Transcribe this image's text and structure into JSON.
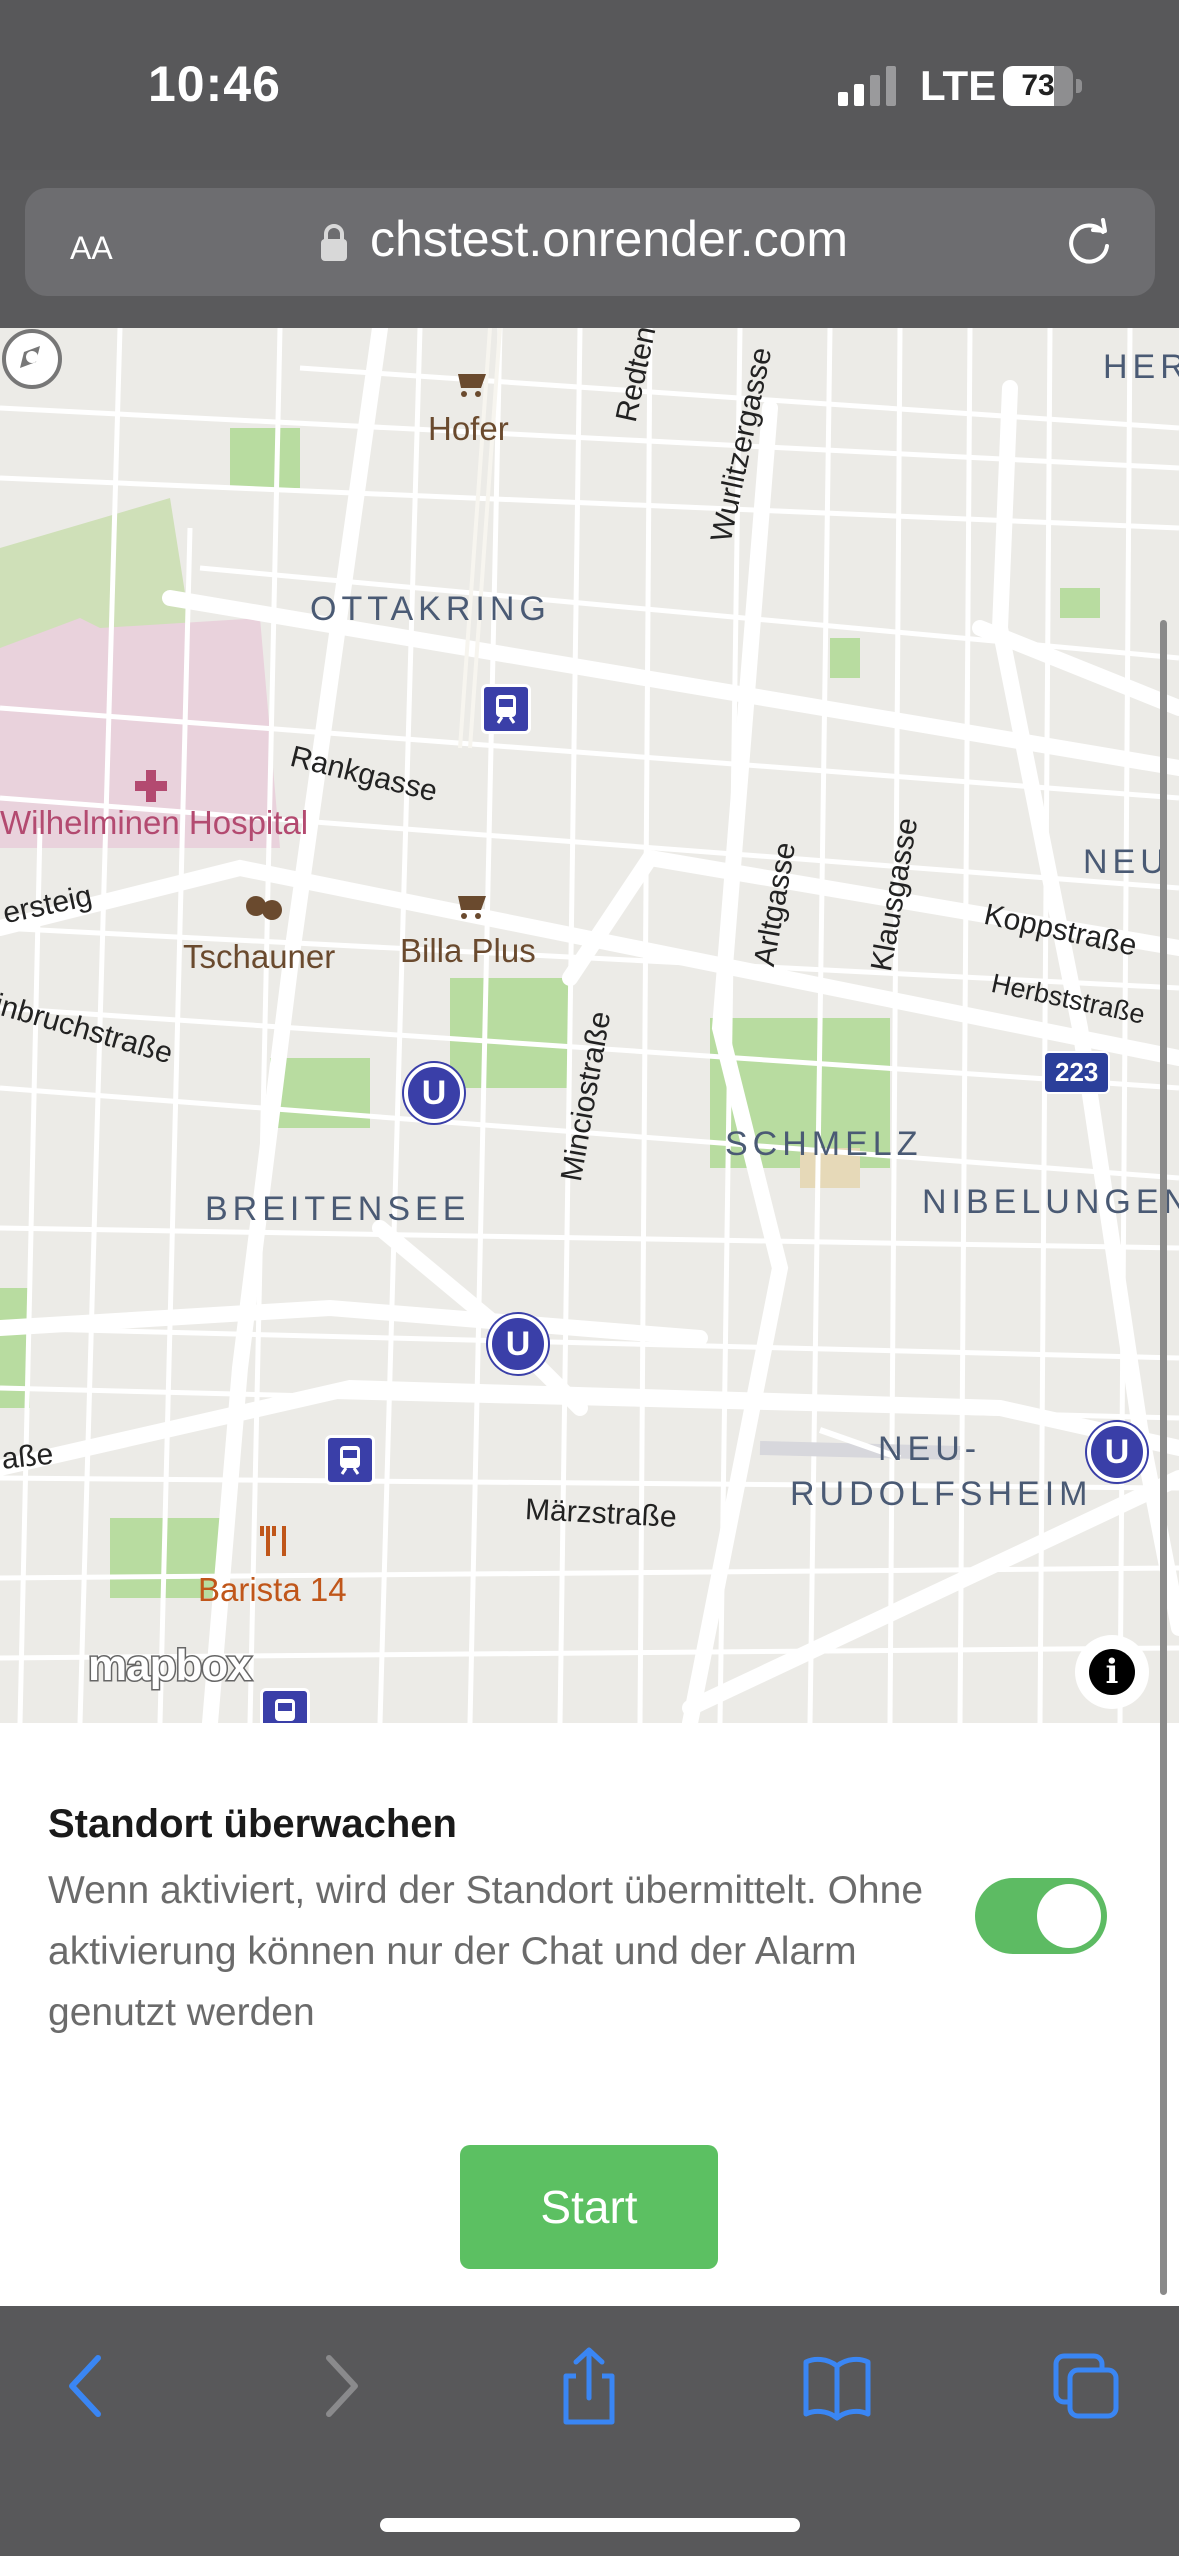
{
  "status_bar": {
    "time": "10:46",
    "network": "LTE",
    "battery": "73",
    "battery_level": 0.73
  },
  "address_bar": {
    "text_size_label": "AA",
    "url": "chstest.onrender.com"
  },
  "map": {
    "districts": [
      "OTTAKRING",
      "BREITENSEE",
      "SCHMELZ",
      "NIBELUNGEN",
      "NEU-",
      "RUDOLFSHEIM",
      "HER",
      "NEU"
    ],
    "streets": [
      "Redtenbacher",
      "Wurlitzergasse",
      "Rankgasse",
      "ersteig",
      "inbruchstraße",
      "Minciostraße",
      "Arltgasse",
      "Klausgasse",
      "Koppstraße",
      "Herbststraße",
      "Märzstraße",
      "aße"
    ],
    "pois": {
      "hofer": "Hofer",
      "hospital": "Wilhelminen Hospital",
      "tschauner": "Tschauner",
      "billa": "Billa Plus",
      "barista": "Barista 14"
    },
    "route_shield": "223",
    "metro_symbol": "U",
    "attribution": "mapbox",
    "info_symbol": "i"
  },
  "panel": {
    "title": "Standort überwachen",
    "description": "Wenn aktiviert, wird der Standort übermittelt. Ohne aktivierung können nur der Chat und der Alarm genutzt werden",
    "toggle_on": true,
    "start_label": "Start"
  },
  "toolbar": {
    "icons": [
      "back-icon",
      "forward-icon",
      "share-icon",
      "bookmarks-icon",
      "tabs-icon"
    ]
  },
  "colors": {
    "accent_green": "#5cc062",
    "toolbar_bg": "#58585a",
    "safari_blue": "#3a86f4",
    "metro_blue": "#3a3fa8"
  }
}
